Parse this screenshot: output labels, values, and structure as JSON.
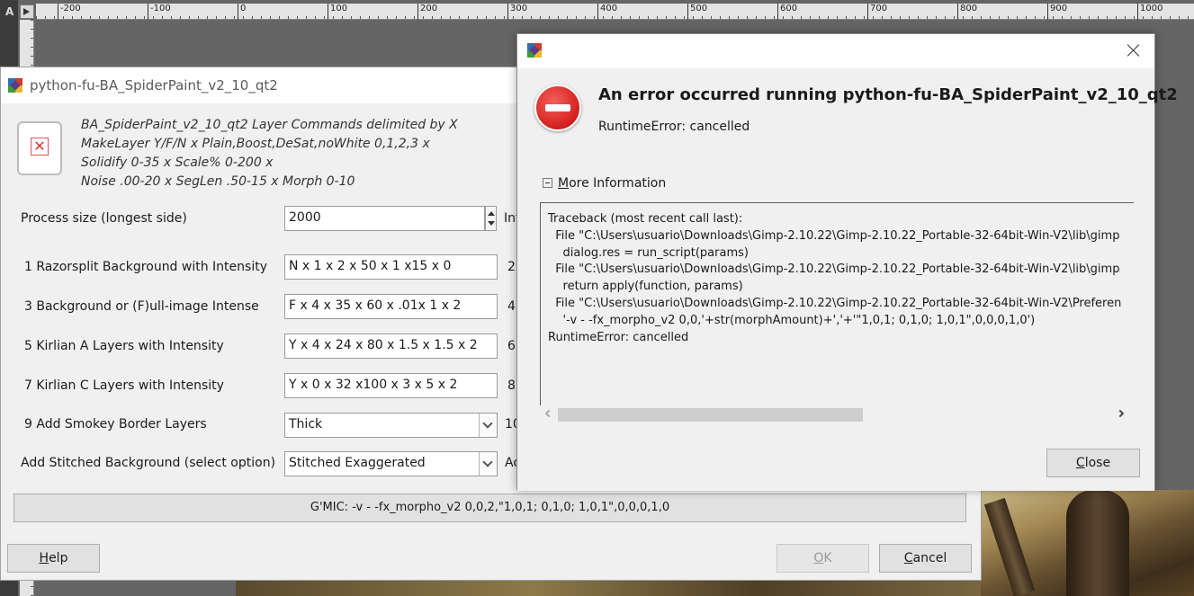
{
  "gimp": {
    "ruler_ticks": [
      "-200",
      "-100",
      "0",
      "100",
      "200",
      "300",
      "400",
      "500",
      "600",
      "700",
      "800",
      "900",
      "1000"
    ]
  },
  "plugin_dialog": {
    "title": "python-fu-BA_SpiderPaint_v2_10_qt2",
    "description_lines": [
      "BA_SpiderPaint_v2_10_qt2 Layer Commands delimited by X",
      "MakeLayer Y/F/N x Plain,Boost,DeSat,noWhite 0,1,2,3 x",
      "Solidify 0-35 x Scale% 0-200 x",
      "Noise .00-20 x SegLen .50-15 x Morph 0-10"
    ],
    "process_size": {
      "label": "Process size (longest side)",
      "value": "2000",
      "side_label": "Int"
    },
    "rows": [
      {
        "label": "1 Razorsplit Background with Intensity",
        "value": "N x 1 x  2 x 50 x 1   x15   x 0",
        "side_num": "2"
      },
      {
        "label": "3 Background or (F)ull-image Intense",
        "value": "F x 4 x 35 x 60 x  .01x 1   x 2",
        "side_num": "4"
      },
      {
        "label": "5 Kirlian A Layers with Intensity",
        "value": "Y x 4 x 24 x 80 x 1.5 x 1.5 x 2",
        "side_num": "6"
      },
      {
        "label": "7 Kirlian C Layers with Intensity",
        "value": "Y x 0 x 32 x100 x 3   x 5   x 2",
        "side_num": "8"
      }
    ],
    "smokey": {
      "label": "9 Add Smokey Border Layers",
      "value": "Thick",
      "side_num": "10"
    },
    "stitched": {
      "label": "Add Stitched Background (select option)",
      "value": "Stitched Exaggerated",
      "side_label": "Ac"
    },
    "gmic_bar": "G'MIC: -v - -fx_morpho_v2 0,0,2,\"1,0,1; 0,1,0; 1,0,1\",0,0,0,1,0",
    "buttons": {
      "help_prefix": "",
      "help_accel": "H",
      "help_rest": "elp",
      "ok_accel": "O",
      "ok_rest": "K",
      "cancel_accel": "C",
      "cancel_rest": "ancel"
    }
  },
  "error_dialog": {
    "heading": "An error occurred running python-fu-BA_SpiderPaint_v2_10_qt2",
    "sub": "RuntimeError: cancelled",
    "more_info_accel": "M",
    "more_info_rest": "ore Information",
    "traceback": "Traceback (most recent call last):\n  File \"C:\\Users\\usuario\\Downloads\\Gimp-2.10.22\\Gimp-2.10.22_Portable-32-64bit-Win-V2\\lib\\gimp\n    dialog.res = run_script(params)\n  File \"C:\\Users\\usuario\\Downloads\\Gimp-2.10.22\\Gimp-2.10.22_Portable-32-64bit-Win-V2\\lib\\gimp\n    return apply(function, params)\n  File \"C:\\Users\\usuario\\Downloads\\Gimp-2.10.22\\Gimp-2.10.22_Portable-32-64bit-Win-V2\\Preferen\n    '-v - -fx_morpho_v2 0,0,'+str(morphAmount)+','+'\"1,0,1; 0,1,0; 1,0,1\",0,0,0,1,0')\nRuntimeError: cancelled",
    "close_accel": "C",
    "close_rest": "lose"
  }
}
